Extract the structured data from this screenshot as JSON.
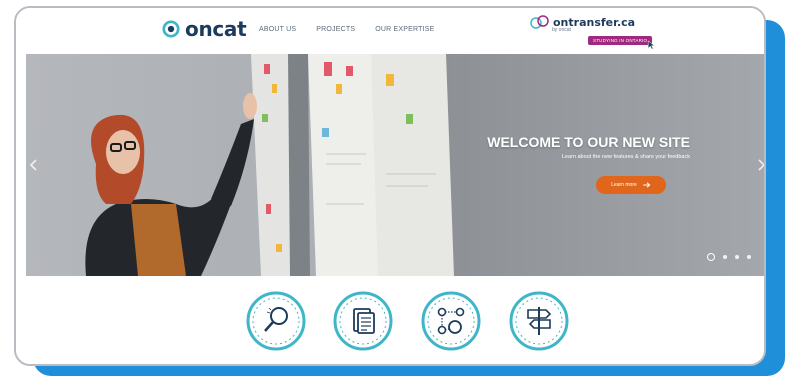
{
  "header": {
    "logo_text": "oncat",
    "nav": [
      "ABOUT US",
      "PROJECTS",
      "OUR EXPERTISE"
    ],
    "partner": {
      "name": "ontransfer.ca",
      "sub": "by oncat",
      "badge": "STUDYING IN ONTARIO"
    }
  },
  "hero": {
    "title": "WELCOME TO OUR NEW SITE",
    "subtitle": "Learn about the new features & share your feedback",
    "cta_label": "Learn more",
    "slide_count": 4,
    "active_slide": 1
  },
  "feature_icons": [
    "magnifier-icon",
    "document-icon",
    "network-icon",
    "signpost-icon"
  ],
  "colors": {
    "accent_blue": "#1e8fd8",
    "teal": "#3fb6c8",
    "navy": "#1d3b5c",
    "cta_orange": "#e0661c",
    "badge_magenta": "#a0287e"
  }
}
